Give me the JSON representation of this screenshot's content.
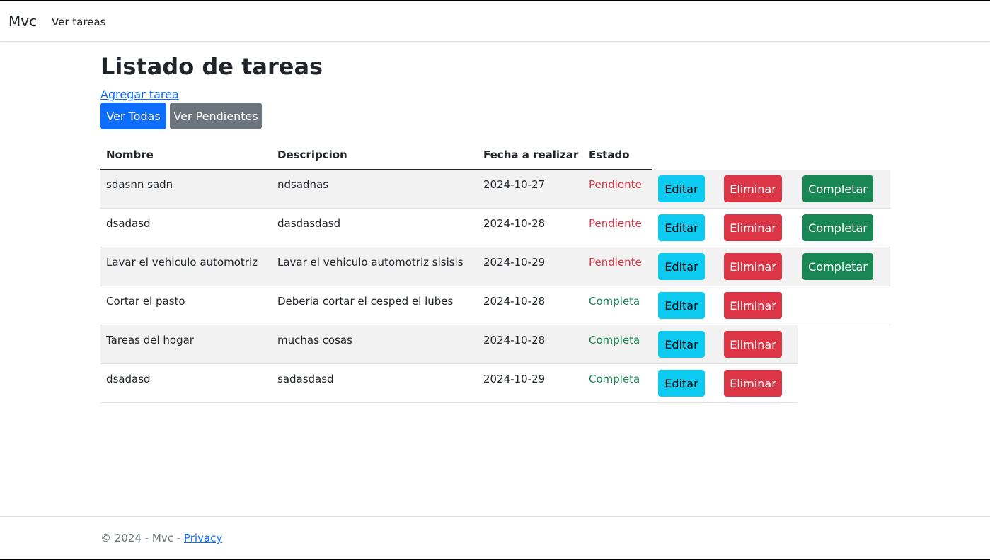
{
  "nav": {
    "brand": "Mvc",
    "link": "Ver tareas"
  },
  "page": {
    "title": "Listado de tareas",
    "add_link": "Agregar tarea",
    "filter_all": "Ver Todas",
    "filter_pending": "Ver Pendientes"
  },
  "table": {
    "headers": {
      "name": "Nombre",
      "description": "Descripcion",
      "date": "Fecha a realizar",
      "state": "Estado"
    },
    "rows": [
      {
        "name": "sdasnn sadn",
        "description": "ndsadnas",
        "date": "2024-10-27",
        "state": "Pendiente",
        "edit": "Editar",
        "delete": "Eliminar",
        "complete": "Completar"
      },
      {
        "name": "dsadasd",
        "description": "dasdasdasd",
        "date": "2024-10-28",
        "state": "Pendiente",
        "edit": "Editar",
        "delete": "Eliminar",
        "complete": "Completar"
      },
      {
        "name": "Lavar el vehiculo automotriz",
        "description": "Lavar el vehiculo automotriz sisisis",
        "date": "2024-10-29",
        "state": "Pendiente",
        "edit": "Editar",
        "delete": "Eliminar",
        "complete": "Completar"
      },
      {
        "name": "Cortar el pasto",
        "description": "Deberia cortar el cesped el lubes",
        "date": "2024-10-28",
        "state": "Completa",
        "edit": "Editar",
        "delete": "Eliminar"
      },
      {
        "name": "Tareas del hogar",
        "description": "muchas cosas",
        "date": "2024-10-28",
        "state": "Completa",
        "edit": "Editar",
        "delete": "Eliminar"
      },
      {
        "name": "dsadasd",
        "description": "sadasdasd",
        "date": "2024-10-29",
        "state": "Completa",
        "edit": "Editar",
        "delete": "Eliminar"
      }
    ]
  },
  "footer": {
    "text": "© 2024 - Mvc - ",
    "privacy": "Privacy"
  },
  "colors": {
    "primary": "#0d6efd",
    "secondary": "#6c757d",
    "info": "#0dcaf0",
    "danger": "#dc3545",
    "success": "#198754"
  }
}
